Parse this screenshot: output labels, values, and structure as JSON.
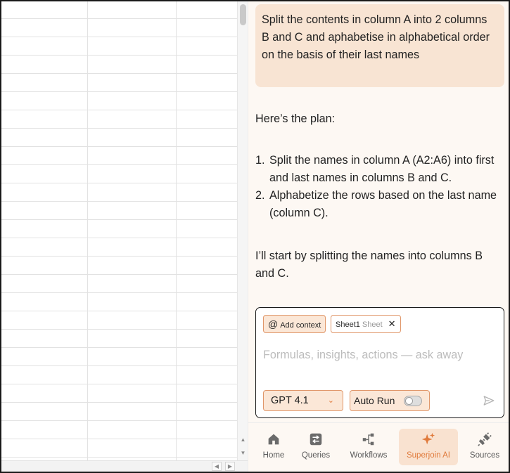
{
  "chat": {
    "user_message": "Split the contents in column A into 2 columns B and C and aphabetise in alphabetical order on the basis of their last names",
    "ai_intro": "Here’s the plan:",
    "plan": [
      {
        "num": "1.",
        "text": "Split the names in column A (A2:A6) into first and last names in columns B and C."
      },
      {
        "num": "2.",
        "text": "Alphabetize the rows based on the last name (column C)."
      }
    ],
    "ai_followup": "I’ll start by splitting the names into columns B and C."
  },
  "composer": {
    "add_context_label": "Add context",
    "context_chip": {
      "name": "Sheet1",
      "type": "Sheet"
    },
    "placeholder": "Formulas, insights, actions — ask away",
    "value": "",
    "model": "GPT 4.1",
    "auto_run_label": "Auto Run",
    "auto_run_enabled": false
  },
  "nav": {
    "items": [
      {
        "label": "Home",
        "icon": "home-icon"
      },
      {
        "label": "Queries",
        "icon": "swap-icon"
      },
      {
        "label": "Workflows",
        "icon": "workflow-icon"
      },
      {
        "label": "Superjoin AI",
        "icon": "sparkle-icon",
        "active": true
      },
      {
        "label": "Sources",
        "icon": "plug-icon"
      }
    ]
  },
  "colors": {
    "accent": "#e07b3d",
    "user_bubble": "#f8e4d3",
    "panel_bg": "#fdf8f3"
  }
}
